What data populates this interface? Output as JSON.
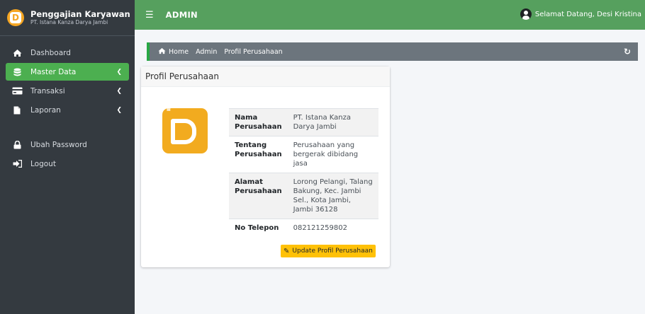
{
  "brand": {
    "title": "Penggajian Karyawan",
    "subtitle": "PT. Istana Kanza Darya Jambi"
  },
  "topbar": {
    "title": "ADMIN",
    "greeting": "Selamat Datang, Desi Kristina"
  },
  "sidebar": {
    "items": [
      {
        "label": "Dashboard",
        "icon": "home-icon"
      },
      {
        "label": "Master Data",
        "icon": "database-icon",
        "active": true
      },
      {
        "label": "Transaksi",
        "icon": "credit-card-icon"
      },
      {
        "label": "Laporan",
        "icon": "file-icon"
      },
      {
        "label": "Ubah Password",
        "icon": "lock-icon"
      },
      {
        "label": "Logout",
        "icon": "sign-out-icon"
      }
    ]
  },
  "breadcrumb": {
    "home": "Home",
    "admin": "Admin",
    "current": "Profil Perusahaan"
  },
  "card": {
    "title": "Profil Perusahaan",
    "rows": [
      {
        "label": "Nama Perusahaan",
        "value": "PT. Istana Kanza Darya Jambi"
      },
      {
        "label": "Tentang Perusahaan",
        "value": "Perusahaan yang bergerak dibidang jasa"
      },
      {
        "label": "Alamat Perusahaan",
        "value": "Lorong Pelangi, Talang Bakung, Kec. Jambi Sel., Kota Jambi, Jambi 36128"
      },
      {
        "label": "No Telepon",
        "value": "082121259802"
      }
    ],
    "update_label": "Update Profil Perusahaan"
  },
  "colors": {
    "sidebar_bg": "#343a40",
    "topbar_bg": "#56a05e",
    "active_item": "#4caf50",
    "button_warning": "#ffc107",
    "logo_orange": "#f2ab1f"
  }
}
